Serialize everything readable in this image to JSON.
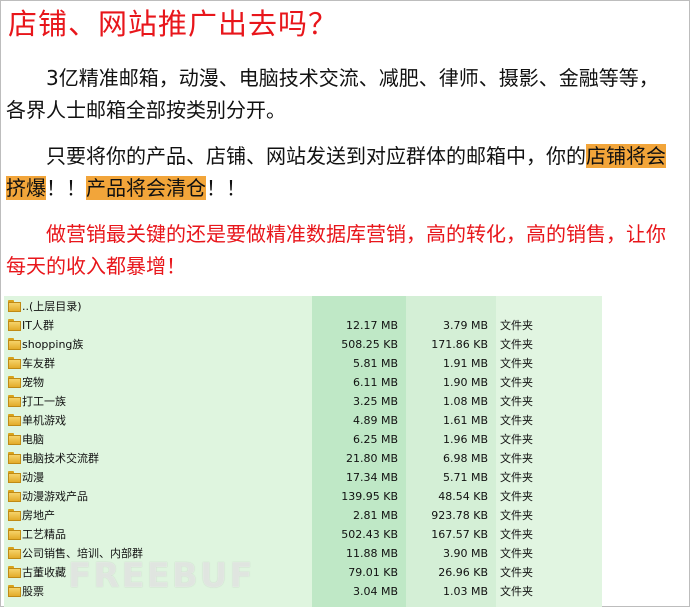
{
  "headline": "店铺、网站推广出去吗？",
  "paragraphs": {
    "p1": "3亿精准邮箱，动漫、电脑技术交流、减肥、律师、摄影、金融等等，各界人士邮箱全部按类别分开。",
    "p2_prefix": "只要将你的产品、店铺、网站发送到对应群体的邮箱中，你的",
    "p2_hl1": "店铺将会挤爆",
    "p2_mid": "！！",
    "p2_hl2": "产品将会清仓",
    "p2_suffix": "！！",
    "p3": "做营销最关键的还是要做精准数据库营销，高的转化，高的销售，让你每天的收入都暴增！"
  },
  "files": {
    "parent": "..(上层目录)",
    "rows": [
      {
        "name": "IT人群",
        "size": "12.17 MB",
        "compressed": "3.79 MB",
        "type": "文件夹"
      },
      {
        "name": "shopping族",
        "size": "508.25 KB",
        "compressed": "171.86 KB",
        "type": "文件夹"
      },
      {
        "name": "车友群",
        "size": "5.81 MB",
        "compressed": "1.91 MB",
        "type": "文件夹"
      },
      {
        "name": "宠物",
        "size": "6.11 MB",
        "compressed": "1.90 MB",
        "type": "文件夹"
      },
      {
        "name": "打工一族",
        "size": "3.25 MB",
        "compressed": "1.08 MB",
        "type": "文件夹"
      },
      {
        "name": "单机游戏",
        "size": "4.89 MB",
        "compressed": "1.61 MB",
        "type": "文件夹"
      },
      {
        "name": "电脑",
        "size": "6.25 MB",
        "compressed": "1.96 MB",
        "type": "文件夹"
      },
      {
        "name": "电脑技术交流群",
        "size": "21.80 MB",
        "compressed": "6.98 MB",
        "type": "文件夹"
      },
      {
        "name": "动漫",
        "size": "17.34 MB",
        "compressed": "5.71 MB",
        "type": "文件夹"
      },
      {
        "name": "动漫游戏产品",
        "size": "139.95 KB",
        "compressed": "48.54 KB",
        "type": "文件夹"
      },
      {
        "name": "房地产",
        "size": "2.81 MB",
        "compressed": "923.78 KB",
        "type": "文件夹"
      },
      {
        "name": "工艺精品",
        "size": "502.43 KB",
        "compressed": "167.57 KB",
        "type": "文件夹"
      },
      {
        "name": "公司销售、培训、内部群",
        "size": "11.88 MB",
        "compressed": "3.90 MB",
        "type": "文件夹"
      },
      {
        "name": "古董收藏",
        "size": "79.01 KB",
        "compressed": "26.96 KB",
        "type": "文件夹"
      },
      {
        "name": "股票",
        "size": "3.04 MB",
        "compressed": "1.03 MB",
        "type": "文件夹"
      }
    ]
  },
  "watermark": "FREEBUF",
  "colors": {
    "accent_red": "#e8161b",
    "highlight_orange": "#f2a53a",
    "list_green": "#bfe8c6"
  }
}
